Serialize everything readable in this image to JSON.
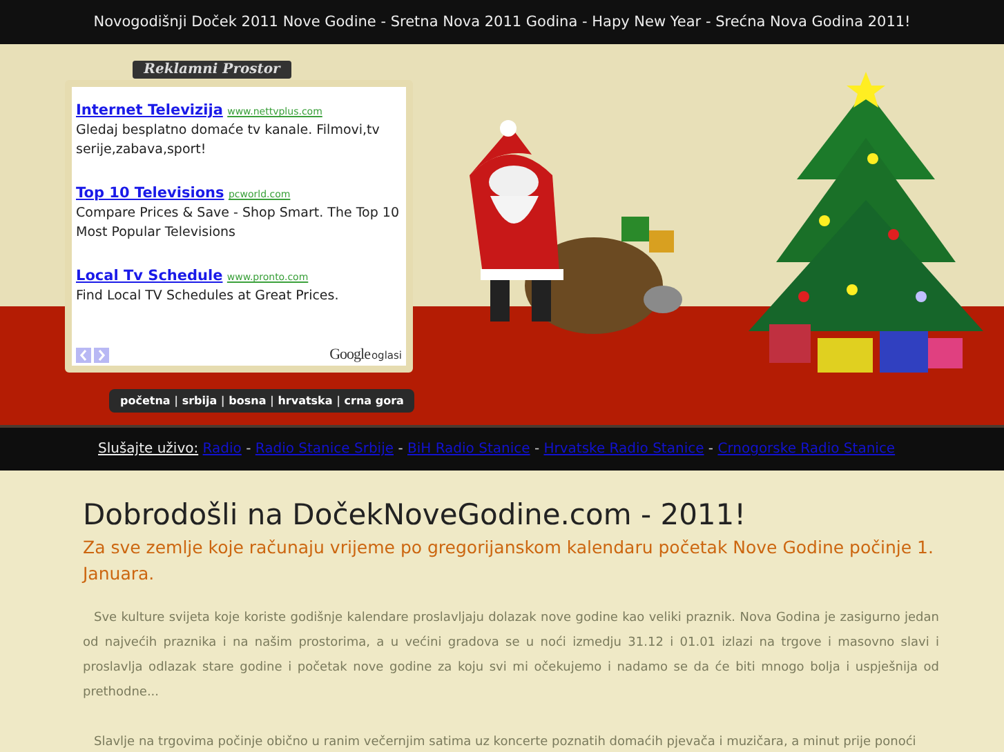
{
  "top_bar": {
    "title": "Novogodišnji Doček 2011 Nove Godine - Sretna Nova 2011 Godina - Hapy New Year - Srećna Nova Godina 2011!"
  },
  "ads": {
    "label": "Reklamni Prostor",
    "items": [
      {
        "title": "Internet Televizija",
        "url": "www.nettvplus.com",
        "text": "Gledaj besplatno domaće tv kanale. Filmovi,tv serije,zabava,sport!"
      },
      {
        "title": "Top 10 Televisions",
        "url": "pcworld.com",
        "text": "Compare Prices & Save - Shop Smart. The Top 10 Most Popular Televisions"
      },
      {
        "title": "Local Tv Schedule",
        "url": "www.pronto.com",
        "text": "Find Local TV Schedules at Great Prices."
      }
    ],
    "brand": "Google",
    "brand_suffix": "oglasi"
  },
  "nav": {
    "items": [
      "početna",
      "srbija",
      "bosna",
      "hrvatska",
      "crna gora"
    ],
    "separator": "|"
  },
  "radio_bar": {
    "label": "Slušajte uživo:",
    "separator": "-",
    "links": [
      "Radio",
      "Radio Stanice Srbije",
      "BiH Radio Stanice",
      "Hrvatske Radio Stanice",
      "Crnogorske Radio Stanice"
    ]
  },
  "content": {
    "heading": "Dobrodošli na DočekNoveGodine.com - 2011!",
    "subheading": "Za sve zemlje koje računaju vrijeme po gregorijanskom kalendaru početak Nove Godine počinje 1. Januara.",
    "paragraphs": [
      "Sve kulture svijeta koje koriste godišnje kalendare proslavljaju dolazak nove godine kao veliki praznik. Nova Godina je zasigurno jedan od najvećih praznika i na našim prostorima, a u većini gradova se u noći izmedju 31.12 i 01.01 izlazi na trgove i masovno slavi i proslavlja odlazak stare godine i početak nove godine za koju svi mi očekujemo i nadamo se da će biti mnogo bolja i uspješnija od prethodne...",
      "Slavlje na trgovima počinje obično u ranim večernjim satima uz koncerte poznatih domaćih pjevača i muzičara, a minut prije ponoći"
    ]
  }
}
